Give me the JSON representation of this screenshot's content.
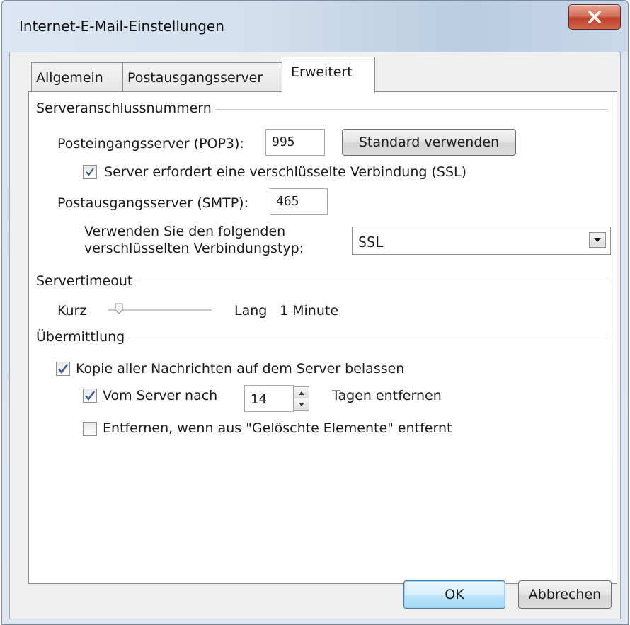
{
  "window": {
    "title": "Internet-E-Mail-Einstellungen",
    "close_icon": "close-icon"
  },
  "tabs": [
    {
      "label": "Allgemein",
      "active": false
    },
    {
      "label": "Postausgangsserver",
      "active": false
    },
    {
      "label": "Erweitert",
      "active": true
    }
  ],
  "ports": {
    "group_title": "Serveranschlussnummern",
    "incoming_label": "Posteingangsserver (POP3):",
    "incoming_value": "995",
    "default_button": "Standard verwenden",
    "ssl_required_label": "Server erfordert eine verschlüsselte Verbindung (SSL)",
    "ssl_required_checked": true,
    "outgoing_label": "Postausgangsserver (SMTP):",
    "outgoing_value": "465",
    "encryption_label_line1": "Verwenden Sie den folgenden",
    "encryption_label_line2": "verschlüsselten Verbindungstyp:",
    "encryption_value": "SSL"
  },
  "timeout": {
    "group_title": "Servertimeout",
    "short_label": "Kurz",
    "long_label": "Lang",
    "value_text": "1 Minute",
    "slider_level": 0.1
  },
  "delivery": {
    "group_title": "Übermittlung",
    "keep_copy_label": "Kopie aller Nachrichten auf dem Server belassen",
    "keep_copy_checked": true,
    "remove_after_label": "Vom Server nach",
    "remove_after_checked": true,
    "days_value": "14",
    "days_suffix": "Tagen entfernen",
    "remove_deleted_label": "Entfernen, wenn aus \"Gelöschte Elemente\" entfernt",
    "remove_deleted_checked": false
  },
  "footer": {
    "ok_label": "OK",
    "cancel_label": "Abbrechen"
  },
  "colors": {
    "close_button": "#c0412b",
    "default_button_border": "#3c7fb1",
    "checkmark": "#2a4a7a"
  }
}
